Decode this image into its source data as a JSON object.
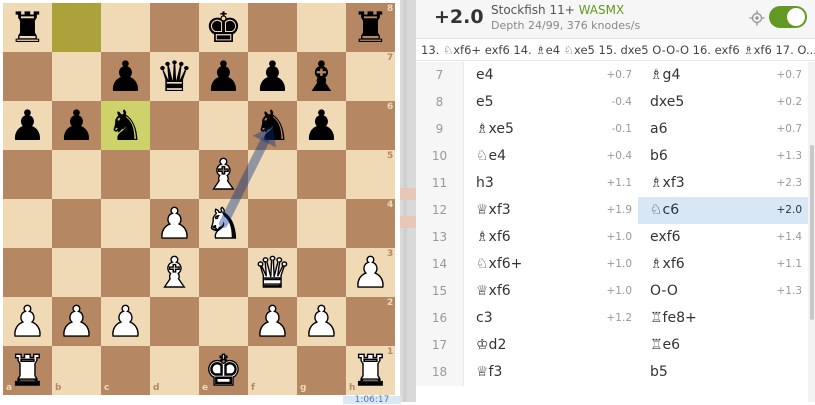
{
  "board": {
    "files": [
      "a",
      "b",
      "c",
      "d",
      "e",
      "f",
      "g",
      "h"
    ],
    "ranks": [
      "8",
      "7",
      "6",
      "5",
      "4",
      "3",
      "2",
      "1"
    ],
    "highlights": [
      "b8",
      "c6"
    ],
    "pieces": [
      {
        "sq": "a8",
        "glyph": "♜",
        "color": "b",
        "name": "black-rook"
      },
      {
        "sq": "e8",
        "glyph": "♚",
        "color": "b",
        "name": "black-king"
      },
      {
        "sq": "h8",
        "glyph": "♜",
        "color": "b",
        "name": "black-rook"
      },
      {
        "sq": "c7",
        "glyph": "♟",
        "color": "b",
        "name": "black-pawn"
      },
      {
        "sq": "d7",
        "glyph": "♛",
        "color": "b",
        "name": "black-queen"
      },
      {
        "sq": "e7",
        "glyph": "♟",
        "color": "b",
        "name": "black-pawn"
      },
      {
        "sq": "f7",
        "glyph": "♟",
        "color": "b",
        "name": "black-pawn"
      },
      {
        "sq": "g7",
        "glyph": "♝",
        "color": "b",
        "name": "black-bishop"
      },
      {
        "sq": "a6",
        "glyph": "♟",
        "color": "b",
        "name": "black-pawn"
      },
      {
        "sq": "b6",
        "glyph": "♟",
        "color": "b",
        "name": "black-pawn"
      },
      {
        "sq": "c6",
        "glyph": "♞",
        "color": "b",
        "name": "black-knight"
      },
      {
        "sq": "f6",
        "glyph": "♞",
        "color": "b",
        "name": "black-knight"
      },
      {
        "sq": "g6",
        "glyph": "♟",
        "color": "b",
        "name": "black-pawn"
      },
      {
        "sq": "e5",
        "glyph": "♝",
        "color": "w",
        "name": "white-bishop"
      },
      {
        "sq": "d4",
        "glyph": "♟",
        "color": "w",
        "name": "white-pawn"
      },
      {
        "sq": "e4",
        "glyph": "♞",
        "color": "w",
        "name": "white-knight"
      },
      {
        "sq": "d3",
        "glyph": "♝",
        "color": "w",
        "name": "white-bishop"
      },
      {
        "sq": "f3",
        "glyph": "♛",
        "color": "w",
        "name": "white-queen"
      },
      {
        "sq": "h3",
        "glyph": "♟",
        "color": "w",
        "name": "white-pawn"
      },
      {
        "sq": "a2",
        "glyph": "♟",
        "color": "w",
        "name": "white-pawn"
      },
      {
        "sq": "b2",
        "glyph": "♟",
        "color": "w",
        "name": "white-pawn"
      },
      {
        "sq": "c2",
        "glyph": "♟",
        "color": "w",
        "name": "white-pawn"
      },
      {
        "sq": "f2",
        "glyph": "♟",
        "color": "w",
        "name": "white-pawn"
      },
      {
        "sq": "g2",
        "glyph": "♟",
        "color": "w",
        "name": "white-pawn"
      },
      {
        "sq": "a1",
        "glyph": "♜",
        "color": "w",
        "name": "white-rook"
      },
      {
        "sq": "e1",
        "glyph": "♚",
        "color": "w",
        "name": "white-king"
      },
      {
        "sq": "h1",
        "glyph": "♜",
        "color": "w",
        "name": "white-rook"
      }
    ],
    "arrow": {
      "from": "e4",
      "to": "f6",
      "color": "#003088"
    }
  },
  "clock_text": "1:06:17",
  "engine": {
    "eval": "+2.0",
    "name": "Stockfish 11+",
    "tag": "WASMX",
    "depth": "Depth 24/99, 376 knodes/s",
    "enabled": true,
    "pv_line": "13. ♘xf6+ exf6 14. ♗e4 ♘xe5 15. dxe5 O-O-O 16. exf6 ♗xf6 17. O..."
  },
  "moves": [
    {
      "num": "7",
      "white": "e4",
      "white_eval": "+0.7",
      "black": "♗g4",
      "black_eval": "+0.7"
    },
    {
      "num": "8",
      "white": "e5",
      "white_eval": "-0.4",
      "black": "dxe5",
      "black_eval": "+0.2"
    },
    {
      "num": "9",
      "white": "♗xe5",
      "white_eval": "-0.1",
      "black": "a6",
      "black_eval": "+0.7"
    },
    {
      "num": "10",
      "white": "♘e4",
      "white_eval": "+0.4",
      "black": "b6",
      "black_eval": "+1.3"
    },
    {
      "num": "11",
      "white": "h3",
      "white_eval": "+1.1",
      "black": "♗xf3",
      "black_eval": "+2.3"
    },
    {
      "num": "12",
      "white": "♕xf3",
      "white_eval": "+1.9",
      "black": "♘c6",
      "black_eval": "+2.0",
      "active": "black"
    },
    {
      "num": "13",
      "white": "♗xf6",
      "white_eval": "+1.0",
      "black": "exf6",
      "black_eval": "+1.4"
    },
    {
      "num": "14",
      "white": "♘xf6+",
      "white_eval": "+1.0",
      "black": "♗xf6",
      "black_eval": "+1.1"
    },
    {
      "num": "15",
      "white": "♕xf6",
      "white_eval": "+1.0",
      "black": "O-O",
      "black_eval": "+1.3"
    },
    {
      "num": "16",
      "white": "c3",
      "white_eval": "+1.2",
      "black": "♖fe8+",
      "black_eval": ""
    },
    {
      "num": "17",
      "white": "♔d2",
      "white_eval": "",
      "black": "♖e6",
      "black_eval": ""
    },
    {
      "num": "18",
      "white": "♕f3",
      "white_eval": "",
      "black": "b5",
      "black_eval": ""
    }
  ]
}
